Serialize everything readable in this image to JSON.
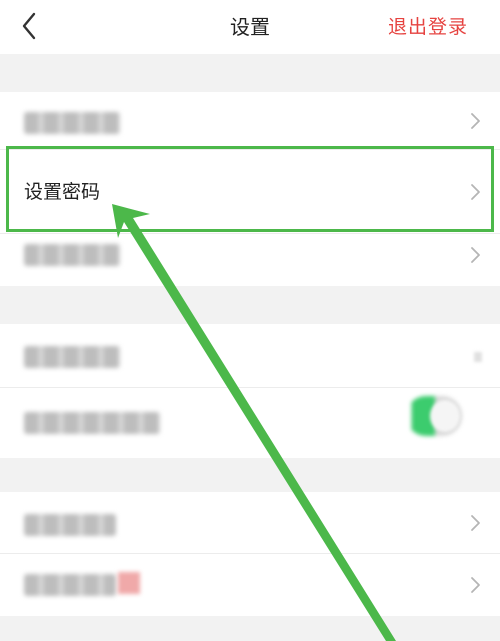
{
  "nav": {
    "title": "设置",
    "logout_label": "退出登录",
    "back_icon": "chevron-left-icon"
  },
  "settings": {
    "set_password_label": "设置密码"
  },
  "colors": {
    "accent_red": "#e64340",
    "highlight_green": "#4cb84a",
    "toggle_on": "#3ccc6e"
  },
  "toggle": {
    "state": "on"
  }
}
